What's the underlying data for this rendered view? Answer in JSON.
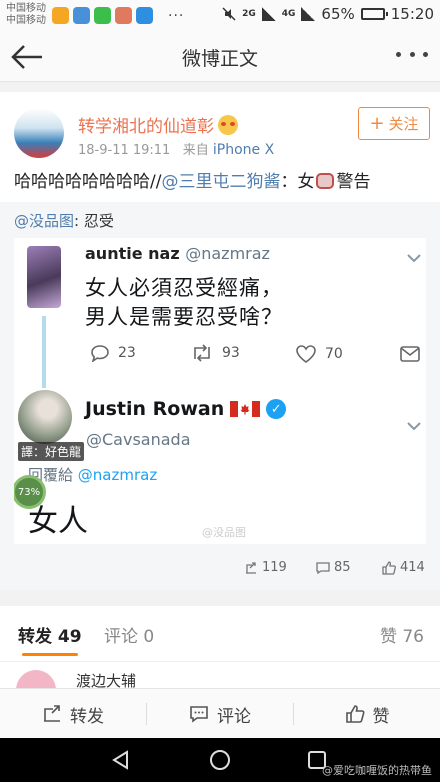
{
  "status_bar": {
    "carrier_line1": "中国移动",
    "carrier_line2": "中国移动",
    "network_a": "2G",
    "network_b": "4G",
    "network_c": "4G",
    "battery": "65%",
    "time": "15:20",
    "app_colors": [
      "#f5a623",
      "#4a90d9",
      "#3cbf4a",
      "#e07a5f",
      "#2e8ee0"
    ]
  },
  "nav": {
    "title": "微博正文"
  },
  "post": {
    "username": "转学湘北的仙道彰",
    "timestamp": "18-9-11 19:11",
    "source_prefix": "来自",
    "source": "iPhone X",
    "follow_label": "关注",
    "text_before": "哈哈哈哈哈哈哈哈//",
    "mention": "@三里屯二狗酱",
    "text_after_mention": "：女",
    "text_end": "警告"
  },
  "repost": {
    "mention": "@没品图",
    "text": ": 忍受",
    "tweet1": {
      "name": "auntie naz",
      "handle": "@nazmraz",
      "line1": "女人必須忍受經痛，",
      "line2": "男人是需要忍受啥？",
      "replies": "23",
      "retweets": "93",
      "likes": "70"
    },
    "tweet2": {
      "name": "Justin Rowan",
      "handle": "@Cavsanada",
      "reply_prefix": "回覆給",
      "reply_mention": "@nazmraz",
      "text": "女人",
      "avatar_tag": "譯：好色龍",
      "progress_badge": "73%"
    },
    "watermark": "@没品图",
    "stats": {
      "reposts": "119",
      "comments": "85",
      "likes": "414"
    }
  },
  "tabs": {
    "repost": "转发 49",
    "comment": "评论 0",
    "likes": "赞 76"
  },
  "comment_peek": {
    "name": "渡边大辅"
  },
  "action_bar": {
    "repost": "转发",
    "comment": "评论",
    "like": "赞"
  },
  "footer_watermark": "@爱吃咖喱饭的热带鱼",
  "colors": {
    "accent_orange": "#ff8200",
    "username_orange": "#eb7350",
    "link_blue": "#507daf",
    "twitter_blue": "#1da1f2"
  }
}
